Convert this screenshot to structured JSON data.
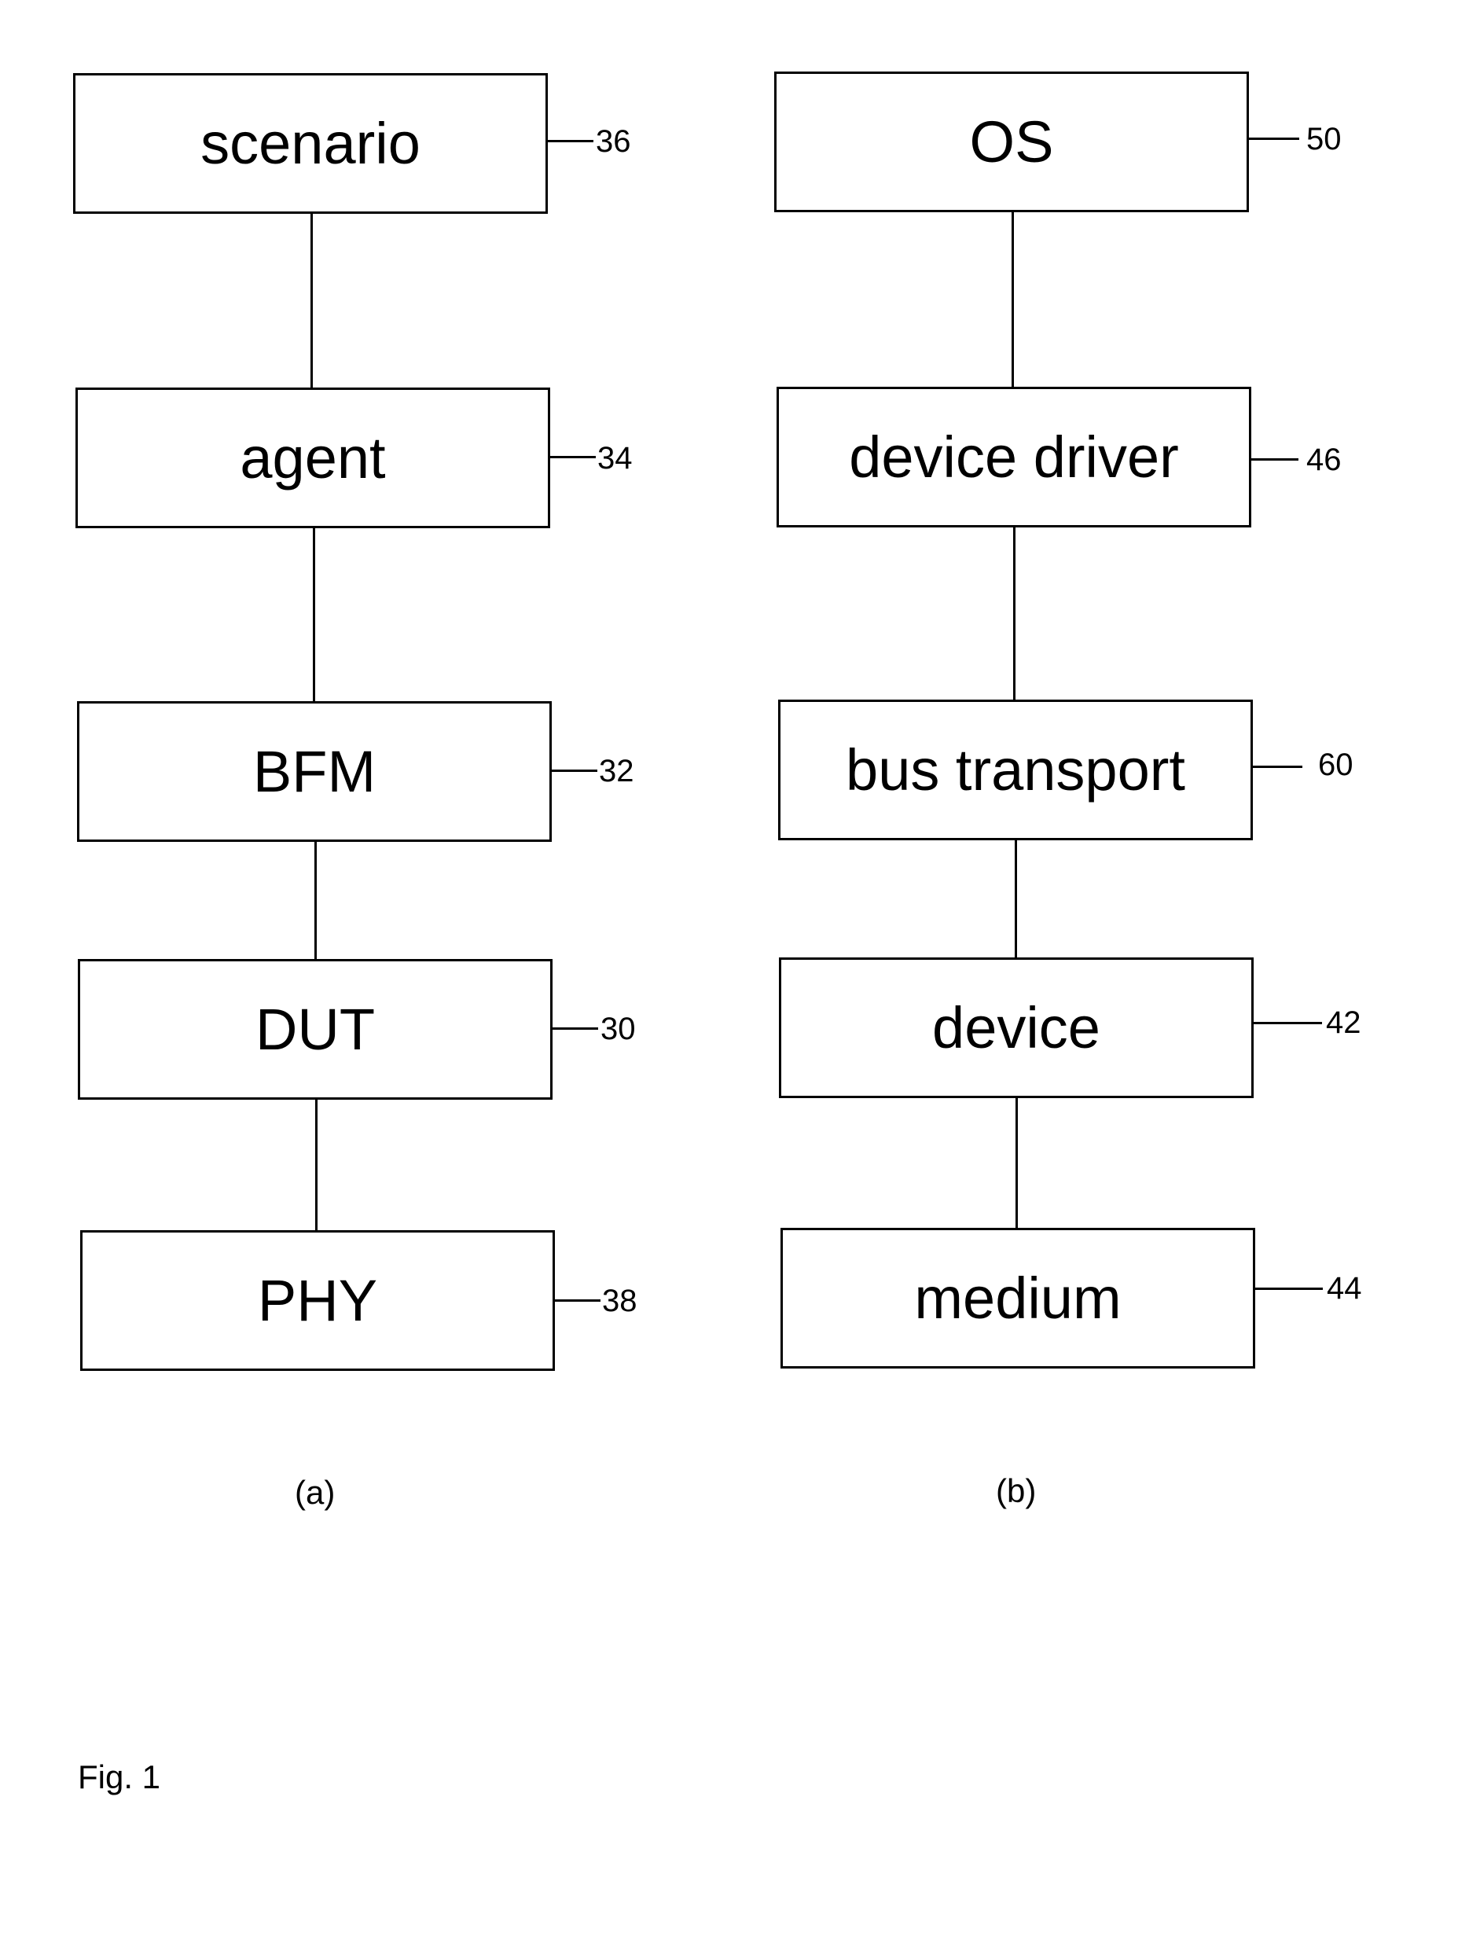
{
  "figure_label": "Fig. 1",
  "diagrams": [
    {
      "id": "a",
      "caption": "(a)",
      "blocks": [
        {
          "label": "scenario",
          "ref": "36"
        },
        {
          "label": "agent",
          "ref": "34"
        },
        {
          "label": "BFM",
          "ref": "32"
        },
        {
          "label": "DUT",
          "ref": "30"
        },
        {
          "label": "PHY",
          "ref": "38"
        }
      ]
    },
    {
      "id": "b",
      "caption": "(b)",
      "blocks": [
        {
          "label": "OS",
          "ref": "50"
        },
        {
          "label": "device driver",
          "ref": "46"
        },
        {
          "label": "bus transport",
          "ref": "60"
        },
        {
          "label": "device",
          "ref": "42"
        },
        {
          "label": "medium",
          "ref": "44"
        }
      ]
    }
  ],
  "connections": [
    {
      "diagram": "a",
      "from": "scenario",
      "to": "agent"
    },
    {
      "diagram": "a",
      "from": "agent",
      "to": "BFM"
    },
    {
      "diagram": "a",
      "from": "BFM",
      "to": "DUT"
    },
    {
      "diagram": "a",
      "from": "DUT",
      "to": "PHY"
    },
    {
      "diagram": "b",
      "from": "OS",
      "to": "device driver"
    },
    {
      "diagram": "b",
      "from": "device driver",
      "to": "bus transport"
    },
    {
      "diagram": "b",
      "from": "bus transport",
      "to": "device"
    },
    {
      "diagram": "b",
      "from": "device",
      "to": "medium"
    }
  ]
}
